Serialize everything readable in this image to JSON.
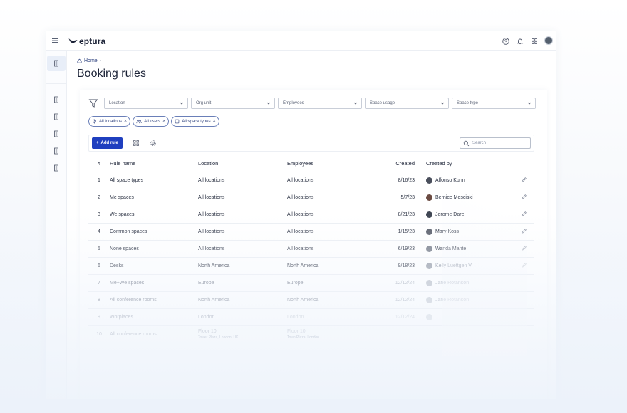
{
  "topbar": {
    "brand": "eptura"
  },
  "breadcrumb": {
    "home": "Home",
    "separator": "›"
  },
  "page": {
    "title": "Booking rules"
  },
  "filters": [
    {
      "label": "Location",
      "width": 118
    },
    {
      "label": "Org unit",
      "width": 118
    },
    {
      "label": "Employees",
      "width": 118
    },
    {
      "label": "Space usage",
      "width": 118
    },
    {
      "label": "Space type",
      "width": 118
    }
  ],
  "chips": [
    "All locations",
    "All users",
    "All space types"
  ],
  "toolbar": {
    "add_label": "Add rule",
    "search_placeholder": "Search"
  },
  "table": {
    "headers": {
      "num": "#",
      "name": "Rule name",
      "location": "Location",
      "employees": "Employees",
      "created": "Created",
      "created_by": "Created by"
    },
    "rows": [
      {
        "num": "1",
        "name": "All space types",
        "location": "All locations",
        "employees": "All locations",
        "created": "8/16/23",
        "by": "Alfonso Kuhn",
        "avatar": "#4a4f5c"
      },
      {
        "num": "2",
        "name": "Me spaces",
        "location": "All locations",
        "employees": "All locations",
        "created": "5/7/23",
        "by": "Bernice Mosciski",
        "avatar": "#6b4b42"
      },
      {
        "num": "3",
        "name": "We spaces",
        "location": "All locations",
        "employees": "All locations",
        "created": "8/21/23",
        "by": "Jerome Dare",
        "avatar": "#3f4653"
      },
      {
        "num": "4",
        "name": "Common spaces",
        "location": "All locations",
        "employees": "All locations",
        "created": "1/15/23",
        "by": "Mary Koss",
        "avatar": "#5a5f6b"
      },
      {
        "num": "5",
        "name": "None spaces",
        "location": "All locations",
        "employees": "All locations",
        "created": "6/19/23",
        "by": "Wanda Mante",
        "avatar": "#7a808c"
      },
      {
        "num": "6",
        "name": "Desks",
        "location": "North America",
        "employees": "North America",
        "created": "9/18/23",
        "by": "Kelly Luettgen V",
        "avatar": "#9aa0ab"
      },
      {
        "num": "7",
        "name": "Me+We spaces",
        "location": "Europe",
        "employees": "Europe",
        "created": "12/12/24",
        "by": "Jane Rotanson",
        "avatar": "#b9bec8"
      },
      {
        "num": "8",
        "name": "All conference rooms",
        "location": "North America",
        "employees": "North America",
        "created": "12/12/24",
        "by": "Jane Rotanson",
        "avatar": "#c3c8d0"
      },
      {
        "num": "9",
        "name": "Worplaces",
        "location": "London",
        "employees": "London",
        "created": "12/12/24",
        "by": "",
        "avatar": "#d5d9e0"
      },
      {
        "num": "10",
        "name": "All conference rooms",
        "location": "Floor 10",
        "location_sub": "Tower Plaza, London, UK",
        "employees": "Floor 10",
        "employees_sub": "Town Plaza, London...",
        "created": "",
        "by": "",
        "avatar": ""
      }
    ]
  }
}
